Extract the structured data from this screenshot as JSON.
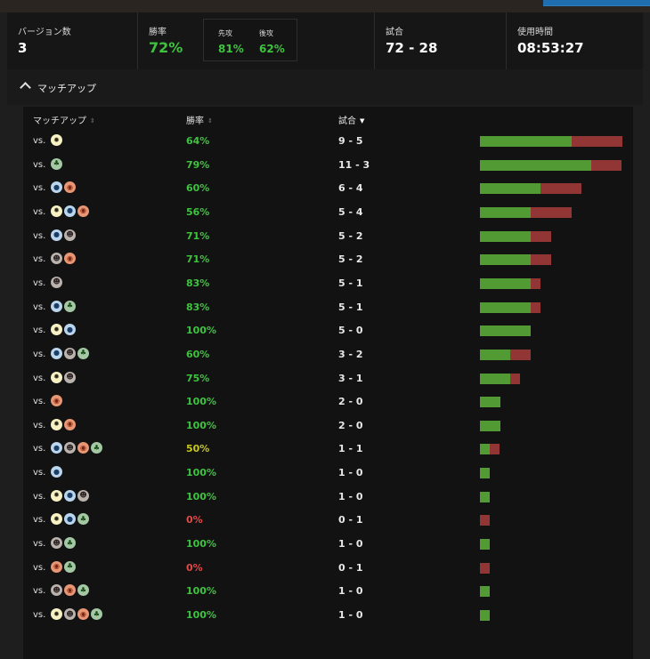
{
  "stats": {
    "versions_label": "バージョン数",
    "versions_value": "3",
    "winrate_label": "勝率",
    "winrate_value": "72%",
    "first_label": "先攻",
    "first_value": "81%",
    "second_label": "後攻",
    "second_value": "62%",
    "matches_label": "試合",
    "matches_value": "72 - 28",
    "playtime_label": "使用時間",
    "playtime_value": "08:53:27"
  },
  "section": {
    "title": "マッチアップ"
  },
  "table": {
    "col_matchup": "マッチアップ",
    "col_winrate": "勝率",
    "col_games": "試合",
    "vs_label": "vs.",
    "colors": {
      "win": "#519a34",
      "loss": "#923535",
      "good": "#3fc33f",
      "mid": "#c7c81e",
      "bad": "#e04848"
    },
    "rows": [
      {
        "icons": [
          "W"
        ],
        "winrate": "64%",
        "record": "9 - 5",
        "wins": 9,
        "losses": 5
      },
      {
        "icons": [
          "G"
        ],
        "winrate": "79%",
        "record": "11 - 3",
        "wins": 11,
        "losses": 3
      },
      {
        "icons": [
          "U",
          "R"
        ],
        "winrate": "60%",
        "record": "6 - 4",
        "wins": 6,
        "losses": 4
      },
      {
        "icons": [
          "W",
          "U",
          "R"
        ],
        "winrate": "56%",
        "record": "5 - 4",
        "wins": 5,
        "losses": 4
      },
      {
        "icons": [
          "U",
          "B"
        ],
        "winrate": "71%",
        "record": "5 - 2",
        "wins": 5,
        "losses": 2
      },
      {
        "icons": [
          "B",
          "R"
        ],
        "winrate": "71%",
        "record": "5 - 2",
        "wins": 5,
        "losses": 2
      },
      {
        "icons": [
          "B"
        ],
        "winrate": "83%",
        "record": "5 - 1",
        "wins": 5,
        "losses": 1
      },
      {
        "icons": [
          "U",
          "G"
        ],
        "winrate": "83%",
        "record": "5 - 1",
        "wins": 5,
        "losses": 1
      },
      {
        "icons": [
          "W",
          "U"
        ],
        "winrate": "100%",
        "record": "5 - 0",
        "wins": 5,
        "losses": 0
      },
      {
        "icons": [
          "U",
          "B",
          "G"
        ],
        "winrate": "60%",
        "record": "3 - 2",
        "wins": 3,
        "losses": 2
      },
      {
        "icons": [
          "W",
          "B"
        ],
        "winrate": "75%",
        "record": "3 - 1",
        "wins": 3,
        "losses": 1
      },
      {
        "icons": [
          "R"
        ],
        "winrate": "100%",
        "record": "2 - 0",
        "wins": 2,
        "losses": 0
      },
      {
        "icons": [
          "W",
          "R"
        ],
        "winrate": "100%",
        "record": "2 - 0",
        "wins": 2,
        "losses": 0
      },
      {
        "icons": [
          "U",
          "B",
          "R",
          "G"
        ],
        "winrate": "50%",
        "record": "1 - 1",
        "wins": 1,
        "losses": 1
      },
      {
        "icons": [
          "U"
        ],
        "winrate": "100%",
        "record": "1 - 0",
        "wins": 1,
        "losses": 0
      },
      {
        "icons": [
          "W",
          "U",
          "B"
        ],
        "winrate": "100%",
        "record": "1 - 0",
        "wins": 1,
        "losses": 0
      },
      {
        "icons": [
          "W",
          "U",
          "G"
        ],
        "winrate": "0%",
        "record": "0 - 1",
        "wins": 0,
        "losses": 1
      },
      {
        "icons": [
          "B",
          "G"
        ],
        "winrate": "100%",
        "record": "1 - 0",
        "wins": 1,
        "losses": 0
      },
      {
        "icons": [
          "R",
          "G"
        ],
        "winrate": "0%",
        "record": "0 - 1",
        "wins": 0,
        "losses": 1
      },
      {
        "icons": [
          "B",
          "R",
          "G"
        ],
        "winrate": "100%",
        "record": "1 - 0",
        "wins": 1,
        "losses": 0
      },
      {
        "icons": [
          "W",
          "B",
          "R",
          "G"
        ],
        "winrate": "100%",
        "record": "1 - 0",
        "wins": 1,
        "losses": 0
      }
    ]
  }
}
